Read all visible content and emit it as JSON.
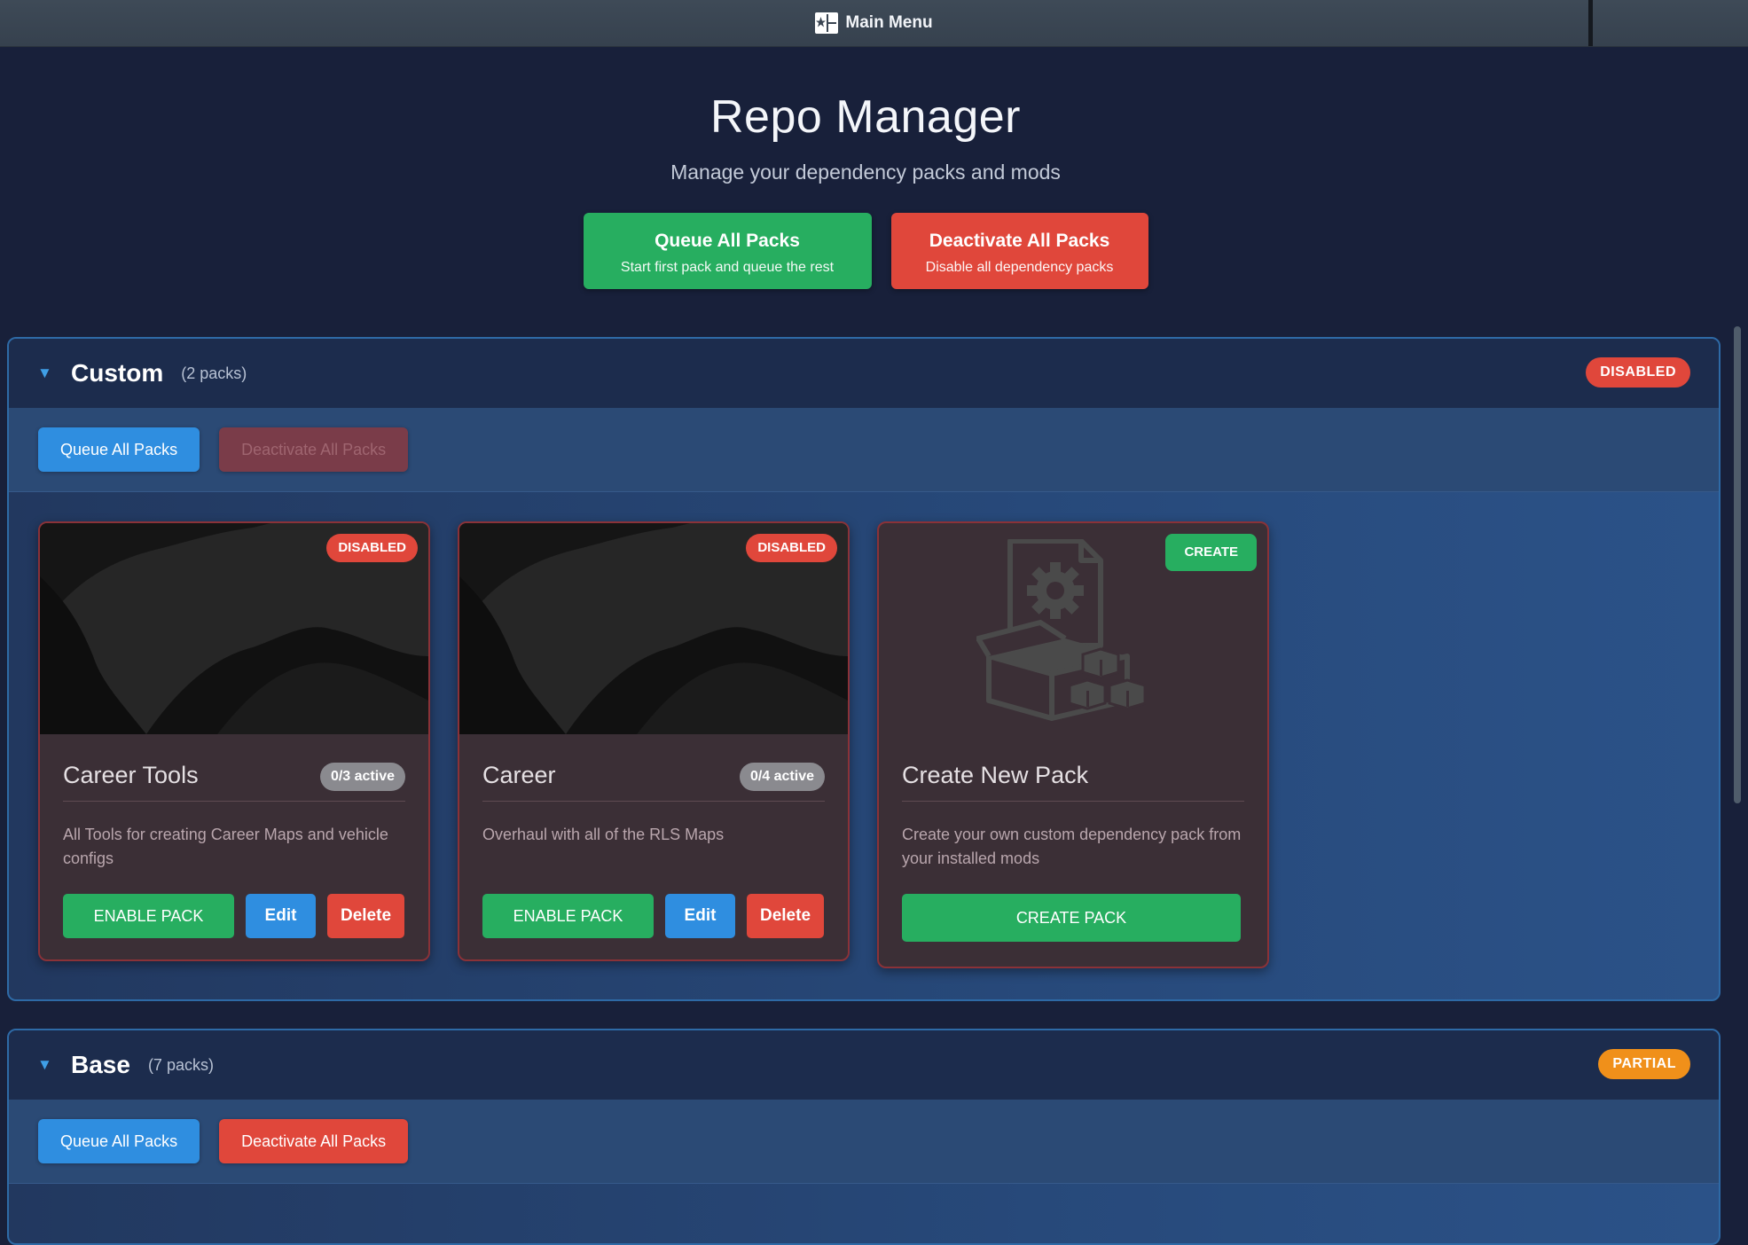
{
  "topbar": {
    "title": "Main Menu"
  },
  "hero": {
    "title": "Repo Manager",
    "subtitle": "Manage your dependency packs and mods",
    "queue_all": {
      "title": "Queue All Packs",
      "subtitle": "Start first pack and queue the rest"
    },
    "deactivate_all": {
      "title": "Deactivate All Packs",
      "subtitle": "Disable all dependency packs"
    }
  },
  "sections": [
    {
      "name": "Custom",
      "count": "(2 packs)",
      "status": "DISABLED",
      "queue_label": "Queue All Packs",
      "deactivate_label": "Deactivate All Packs",
      "cards": [
        {
          "title": "Career Tools",
          "status": "DISABLED",
          "active": "0/3 active",
          "description": "All Tools for creating Career Maps and vehicle configs",
          "enable_label": "ENABLE PACK",
          "edit_label": "Edit",
          "delete_label": "Delete"
        },
        {
          "title": "Career",
          "status": "DISABLED",
          "active": "0/4 active",
          "description": "Overhaul with all of the RLS Maps",
          "enable_label": "ENABLE PACK",
          "edit_label": "Edit",
          "delete_label": "Delete"
        },
        {
          "title": "Create New Pack",
          "status": "CREATE",
          "description": "Create your own custom dependency pack from your installed mods",
          "create_label": "CREATE PACK"
        }
      ]
    },
    {
      "name": "Base",
      "count": "(7 packs)",
      "status": "PARTIAL",
      "queue_label": "Queue All Packs",
      "deactivate_label": "Deactivate All Packs"
    }
  ],
  "icons": {
    "main_menu": "main-menu-icon",
    "collapse": "collapse-triangle-icon",
    "create_pack": "package-gear-icon"
  },
  "colors": {
    "green": "#27ae60",
    "red": "#e0473b",
    "blue": "#2f8ee0",
    "orange": "#f0901a"
  }
}
